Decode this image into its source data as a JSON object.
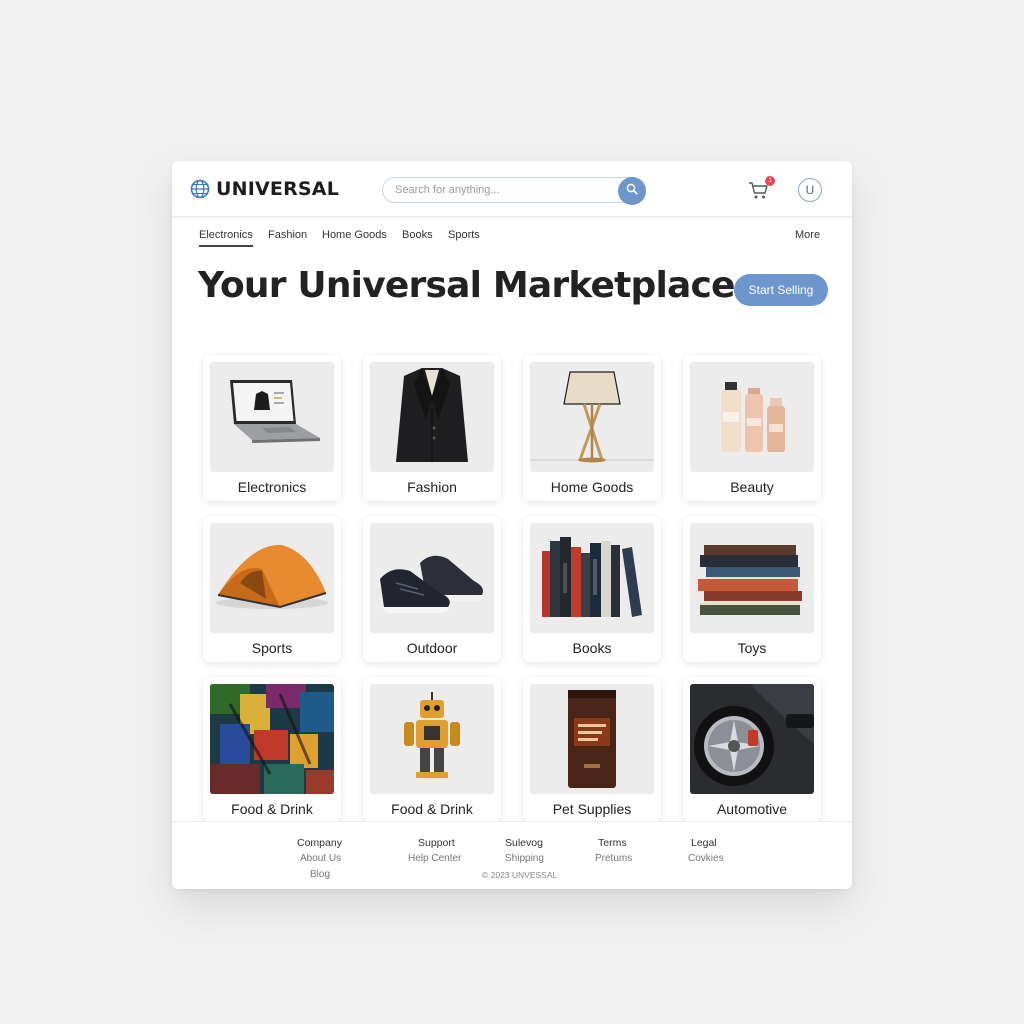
{
  "header": {
    "logo_text": "UNIVERSAL",
    "search_placeholder": "Search for anything...",
    "cart_count": "1",
    "avatar_initial": "U"
  },
  "nav": {
    "items": [
      "Electronics",
      "Fashion",
      "Home Goods",
      "Books",
      "Sports"
    ],
    "active": "Electronics",
    "more_label": "More"
  },
  "hero": {
    "title": "Your Universal Marketplace",
    "cta_label": "Start Selling"
  },
  "categories": [
    {
      "label": "Electronics",
      "icon": "laptop-image"
    },
    {
      "label": "Fashion",
      "icon": "blazer-image"
    },
    {
      "label": "Home Goods",
      "icon": "lamp-image"
    },
    {
      "label": "Beauty",
      "icon": "cosmetics-image"
    },
    {
      "label": "Sports",
      "icon": "tent-image"
    },
    {
      "label": "Outdoor",
      "icon": "sneaker-image"
    },
    {
      "label": "Books",
      "icon": "books-row-image"
    },
    {
      "label": "Toys",
      "icon": "book-stack-image"
    },
    {
      "label": "Food & Drink",
      "icon": "abstract-painting-image"
    },
    {
      "label": "Food & Drink",
      "icon": "robot-toy-image"
    },
    {
      "label": "Pet Supplies",
      "icon": "coffee-bag-image"
    },
    {
      "label": "Automotive",
      "icon": "car-wheel-image"
    }
  ],
  "footer": {
    "col1": {
      "heading": "Company",
      "links": [
        "About Us",
        "Blog"
      ]
    },
    "col2": {
      "heading": "Support",
      "links": [
        "Help Center"
      ]
    },
    "col3": {
      "heading": "Sulevog",
      "links": [
        "Shipping"
      ]
    },
    "col4": {
      "heading": "Terms",
      "links": [
        "Pretums"
      ]
    },
    "col5": {
      "heading": "Legal",
      "links": [
        "Covkies"
      ]
    },
    "copyright": "© 2023 UNVESSAL"
  },
  "colors": {
    "accent": "#6d97cc",
    "badge": "#e5484d",
    "page_bg": "#f1f1f2"
  }
}
